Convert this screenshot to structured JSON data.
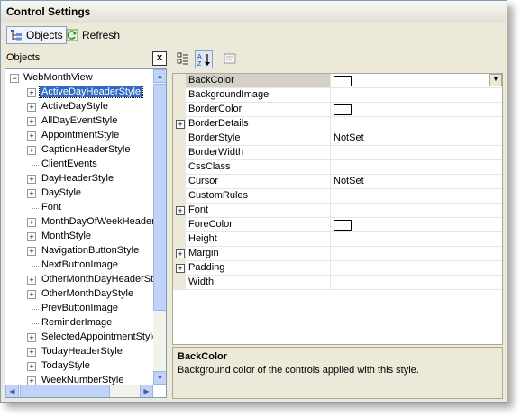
{
  "window": {
    "title": "Control Settings"
  },
  "toolbar": {
    "objects_label": "Objects",
    "refresh_label": "Refresh"
  },
  "left_panel": {
    "header": "Objects",
    "close_glyph": "x"
  },
  "tree": {
    "root": "WebMonthView",
    "items": [
      {
        "label": "ActiveDayHeaderStyle",
        "expandable": true,
        "selected": true
      },
      {
        "label": "ActiveDayStyle",
        "expandable": true
      },
      {
        "label": "AllDayEventStyle",
        "expandable": true
      },
      {
        "label": "AppointmentStyle",
        "expandable": true
      },
      {
        "label": "CaptionHeaderStyle",
        "expandable": true
      },
      {
        "label": "ClientEvents",
        "expandable": false
      },
      {
        "label": "DayHeaderStyle",
        "expandable": true
      },
      {
        "label": "DayStyle",
        "expandable": true
      },
      {
        "label": "Font",
        "expandable": false
      },
      {
        "label": "MonthDayOfWeekHeaderStyle",
        "expandable": true
      },
      {
        "label": "MonthStyle",
        "expandable": true
      },
      {
        "label": "NavigationButtonStyle",
        "expandable": true
      },
      {
        "label": "NextButtonImage",
        "expandable": false
      },
      {
        "label": "OtherMonthDayHeaderStyle",
        "expandable": true
      },
      {
        "label": "OtherMonthDayStyle",
        "expandable": true
      },
      {
        "label": "PrevButtonImage",
        "expandable": false
      },
      {
        "label": "ReminderImage",
        "expandable": false
      },
      {
        "label": "SelectedAppointmentStyle",
        "expandable": true
      },
      {
        "label": "TodayHeaderStyle",
        "expandable": true
      },
      {
        "label": "TodayStyle",
        "expandable": true
      },
      {
        "label": "WeekNumberStyle",
        "expandable": true
      }
    ]
  },
  "properties": [
    {
      "name": "BackColor",
      "value": "",
      "type": "color",
      "expandable": false,
      "selected": true,
      "has_dropdown": true
    },
    {
      "name": "BackgroundImage",
      "value": "",
      "type": "text",
      "expandable": false
    },
    {
      "name": "BorderColor",
      "value": "",
      "type": "color",
      "expandable": false
    },
    {
      "name": "BorderDetails",
      "value": "",
      "type": "text",
      "expandable": true
    },
    {
      "name": "BorderStyle",
      "value": "NotSet",
      "type": "text",
      "expandable": false
    },
    {
      "name": "BorderWidth",
      "value": "",
      "type": "text",
      "expandable": false
    },
    {
      "name": "CssClass",
      "value": "",
      "type": "text",
      "expandable": false
    },
    {
      "name": "Cursor",
      "value": "NotSet",
      "type": "text",
      "expandable": false
    },
    {
      "name": "CustomRules",
      "value": "",
      "type": "text",
      "expandable": false
    },
    {
      "name": "Font",
      "value": "",
      "type": "text",
      "expandable": true
    },
    {
      "name": "ForeColor",
      "value": "",
      "type": "color",
      "expandable": false
    },
    {
      "name": "Height",
      "value": "",
      "type": "text",
      "expandable": false
    },
    {
      "name": "Margin",
      "value": "",
      "type": "text",
      "expandable": true
    },
    {
      "name": "Padding",
      "value": "",
      "type": "text",
      "expandable": true
    },
    {
      "name": "Width",
      "value": "",
      "type": "text",
      "expandable": false
    }
  ],
  "description": {
    "title": "BackColor",
    "text": "Background color of the controls applied with this style."
  },
  "colors": {
    "selection": "#316ac5",
    "window_bg": "#ece9d8",
    "scrollbar": "#c1d3fb"
  }
}
